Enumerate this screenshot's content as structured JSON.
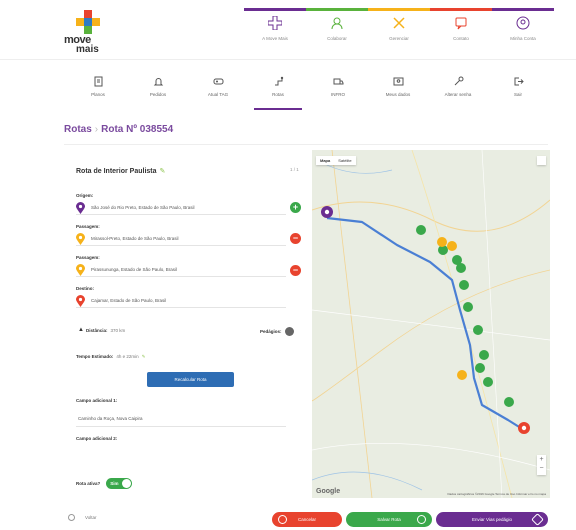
{
  "header": {
    "logo": {
      "word1": "move",
      "word2": "mais"
    },
    "nav": [
      {
        "label": "A Move Mais",
        "icon": "move-mais-icon",
        "color": "#6a2d91"
      },
      {
        "label": "Colaborar",
        "icon": "person-icon",
        "color": "#59b23c"
      },
      {
        "label": "Gerenciar",
        "icon": "tools-icon",
        "color": "#f6b21a"
      },
      {
        "label": "Contato",
        "icon": "chat-icon",
        "color": "#e8432e"
      },
      {
        "label": "Minha Conta",
        "icon": "user-icon",
        "color": "#6a2d91"
      }
    ]
  },
  "subnav": [
    {
      "label": "Planos",
      "icon": "clipboard-icon"
    },
    {
      "label": "Pedidos",
      "icon": "bell-icon"
    },
    {
      "label": "Atual TAG",
      "icon": "tag-icon"
    },
    {
      "label": "Rotas",
      "icon": "route-icon",
      "active": true
    },
    {
      "label": "INFRO",
      "icon": "truck-icon"
    },
    {
      "label": "Meus dados",
      "icon": "id-card-icon"
    },
    {
      "label": "Alterar senha",
      "icon": "key-icon"
    },
    {
      "label": "Sair",
      "icon": "logout-icon"
    }
  ],
  "breadcrumb": {
    "root": "Rotas",
    "separator": "›",
    "current": "Rota Nº 038554"
  },
  "route": {
    "title": "Rota de Interior Paulista",
    "count": "1 / 1",
    "origin_label": "Origem:",
    "origin": "São José do Rio Preto, Estado de São Paulo, Brasil",
    "stop1_label": "Passagem:",
    "stop1": "Mirassol-Preto, Estado de São Paulo, Brasil",
    "stop2_label": "Passagem:",
    "stop2": "Pirassununga, Estado de São Paulo, Brasil",
    "dest_label": "Destino:",
    "dest": "Cajamar, Estado de São Paulo, Brasil",
    "distance_label": "Distância:",
    "distance": "370 km",
    "tolls_label": "Pedágios:",
    "time_label": "Tempo Estimado:",
    "time": "4h e 22min",
    "recalc_label": "Recalcular Rota",
    "extra1_label": "Campo adicional 1:",
    "extra1_value": "Caminho da Roça, Nova Caipira",
    "extra2_label": "Campo adicional 2:",
    "active_label": "Rota ativa?",
    "active_value": "Sim"
  },
  "map": {
    "type_map": "Mapa",
    "type_sat": "Satélite",
    "google": "Google",
    "attribution": "Dados cartográficos ©2016 Google   Termos de Uso   Informar erro no mapa"
  },
  "footer": {
    "back_label": "Voltar",
    "cancel_label": "Cancelar",
    "save_label": "Salvar Rota",
    "send_label": "Enviar Vias pedágio"
  },
  "colors": {
    "purple": "#6a2d91",
    "green": "#3aa84b",
    "red": "#e8432e",
    "blue": "#2e6db4",
    "orange": "#f6b21a"
  }
}
